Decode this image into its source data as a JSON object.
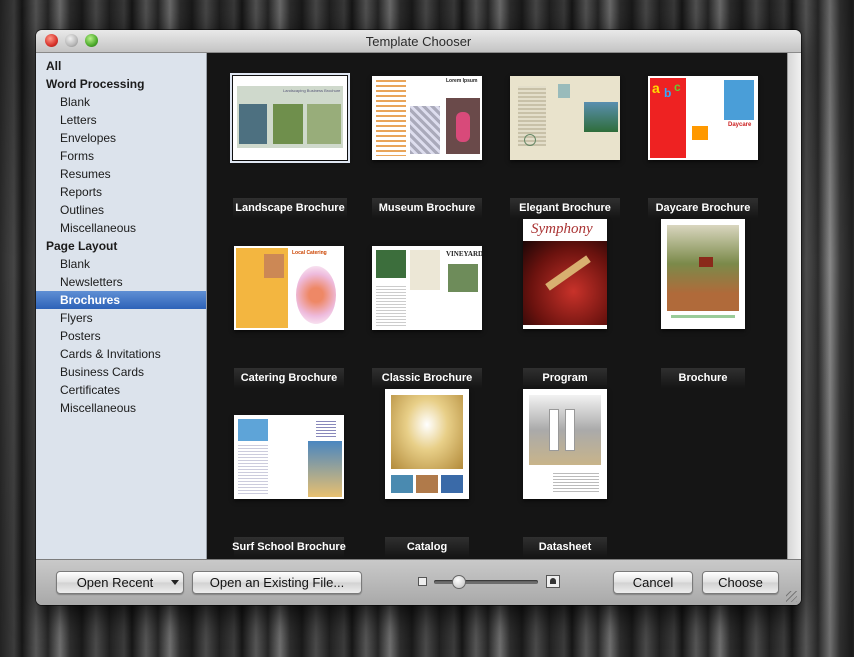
{
  "window": {
    "title": "Template Chooser"
  },
  "sidebar": {
    "items": [
      {
        "label": "All",
        "level": "head"
      },
      {
        "label": "Word Processing",
        "level": "head"
      },
      {
        "label": "Blank",
        "level": "sub"
      },
      {
        "label": "Letters",
        "level": "sub"
      },
      {
        "label": "Envelopes",
        "level": "sub"
      },
      {
        "label": "Forms",
        "level": "sub"
      },
      {
        "label": "Resumes",
        "level": "sub"
      },
      {
        "label": "Reports",
        "level": "sub"
      },
      {
        "label": "Outlines",
        "level": "sub"
      },
      {
        "label": "Miscellaneous",
        "level": "sub"
      },
      {
        "label": "Page Layout",
        "level": "head"
      },
      {
        "label": "Blank",
        "level": "sub"
      },
      {
        "label": "Newsletters",
        "level": "sub"
      },
      {
        "label": "Brochures",
        "level": "sub",
        "selected": true
      },
      {
        "label": "Flyers",
        "level": "sub"
      },
      {
        "label": "Posters",
        "level": "sub"
      },
      {
        "label": "Cards & Invitations",
        "level": "sub"
      },
      {
        "label": "Business Cards",
        "level": "sub"
      },
      {
        "label": "Certificates",
        "level": "sub"
      },
      {
        "label": "Miscellaneous",
        "level": "sub"
      }
    ]
  },
  "templates": [
    {
      "label": "Landscape Brochure",
      "selected": true,
      "thumb_text": "Landscaping Business Brochure"
    },
    {
      "label": "Museum Brochure",
      "thumb_text": "Lorem Ipsum"
    },
    {
      "label": "Elegant Brochure",
      "thumb_text": ""
    },
    {
      "label": "Daycare Brochure",
      "thumb_text": "Daycare"
    },
    {
      "label": "Catering Brochure",
      "thumb_text": "Local Catering"
    },
    {
      "label": "Classic Brochure",
      "thumb_text": "VINEYARD"
    },
    {
      "label": "Program",
      "thumb_text": "Symphony"
    },
    {
      "label": "Brochure",
      "thumb_text": ""
    },
    {
      "label": "Surf School Brochure",
      "thumb_text": ""
    },
    {
      "label": "Catalog",
      "thumb_text": ""
    },
    {
      "label": "Datasheet",
      "thumb_text": ""
    }
  ],
  "bottom": {
    "open_recent": "Open Recent",
    "open_existing": "Open an Existing File...",
    "cancel": "Cancel",
    "choose": "Choose",
    "zoom_level": 0.2
  },
  "colors": {
    "selection": "#3a6fc4",
    "content_bg": "#151515",
    "sidebar_bg": "#dce3ec"
  }
}
